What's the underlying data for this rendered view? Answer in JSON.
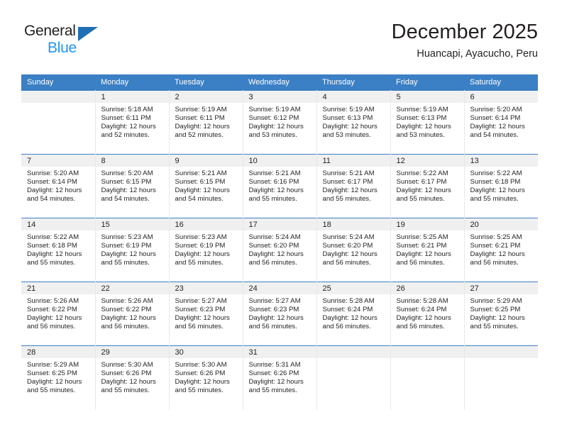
{
  "brand": {
    "name_top": "General",
    "name_bottom": "Blue",
    "triangle_color": "#1f6fb4",
    "blue_text_color": "#2196f3"
  },
  "header": {
    "title": "December 2025",
    "subtitle": "Huancapi, Ayacucho, Peru"
  },
  "theme": {
    "header_bg": "#3b7fc4",
    "header_text": "#ffffff",
    "daynum_bg": "#f0f0f0",
    "cell_border": "#e8e8e8",
    "text": "#231f20"
  },
  "labels": {
    "sunrise_prefix": "Sunrise: ",
    "sunset_prefix": "Sunset: ",
    "daylight_prefix": "Daylight: "
  },
  "weekdays": [
    "Sunday",
    "Monday",
    "Tuesday",
    "Wednesday",
    "Thursday",
    "Friday",
    "Saturday"
  ],
  "weeks": [
    [
      {
        "day": ""
      },
      {
        "day": "1",
        "sunrise": "Sunrise: 5:18 AM",
        "sunset": "Sunset: 6:11 PM",
        "daylight": "Daylight: 12 hours and 52 minutes."
      },
      {
        "day": "2",
        "sunrise": "Sunrise: 5:19 AM",
        "sunset": "Sunset: 6:11 PM",
        "daylight": "Daylight: 12 hours and 52 minutes."
      },
      {
        "day": "3",
        "sunrise": "Sunrise: 5:19 AM",
        "sunset": "Sunset: 6:12 PM",
        "daylight": "Daylight: 12 hours and 53 minutes."
      },
      {
        "day": "4",
        "sunrise": "Sunrise: 5:19 AM",
        "sunset": "Sunset: 6:13 PM",
        "daylight": "Daylight: 12 hours and 53 minutes."
      },
      {
        "day": "5",
        "sunrise": "Sunrise: 5:19 AM",
        "sunset": "Sunset: 6:13 PM",
        "daylight": "Daylight: 12 hours and 53 minutes."
      },
      {
        "day": "6",
        "sunrise": "Sunrise: 5:20 AM",
        "sunset": "Sunset: 6:14 PM",
        "daylight": "Daylight: 12 hours and 54 minutes."
      }
    ],
    [
      {
        "day": "7",
        "sunrise": "Sunrise: 5:20 AM",
        "sunset": "Sunset: 6:14 PM",
        "daylight": "Daylight: 12 hours and 54 minutes."
      },
      {
        "day": "8",
        "sunrise": "Sunrise: 5:20 AM",
        "sunset": "Sunset: 6:15 PM",
        "daylight": "Daylight: 12 hours and 54 minutes."
      },
      {
        "day": "9",
        "sunrise": "Sunrise: 5:21 AM",
        "sunset": "Sunset: 6:15 PM",
        "daylight": "Daylight: 12 hours and 54 minutes."
      },
      {
        "day": "10",
        "sunrise": "Sunrise: 5:21 AM",
        "sunset": "Sunset: 6:16 PM",
        "daylight": "Daylight: 12 hours and 55 minutes."
      },
      {
        "day": "11",
        "sunrise": "Sunrise: 5:21 AM",
        "sunset": "Sunset: 6:17 PM",
        "daylight": "Daylight: 12 hours and 55 minutes."
      },
      {
        "day": "12",
        "sunrise": "Sunrise: 5:22 AM",
        "sunset": "Sunset: 6:17 PM",
        "daylight": "Daylight: 12 hours and 55 minutes."
      },
      {
        "day": "13",
        "sunrise": "Sunrise: 5:22 AM",
        "sunset": "Sunset: 6:18 PM",
        "daylight": "Daylight: 12 hours and 55 minutes."
      }
    ],
    [
      {
        "day": "14",
        "sunrise": "Sunrise: 5:22 AM",
        "sunset": "Sunset: 6:18 PM",
        "daylight": "Daylight: 12 hours and 55 minutes."
      },
      {
        "day": "15",
        "sunrise": "Sunrise: 5:23 AM",
        "sunset": "Sunset: 6:19 PM",
        "daylight": "Daylight: 12 hours and 55 minutes."
      },
      {
        "day": "16",
        "sunrise": "Sunrise: 5:23 AM",
        "sunset": "Sunset: 6:19 PM",
        "daylight": "Daylight: 12 hours and 55 minutes."
      },
      {
        "day": "17",
        "sunrise": "Sunrise: 5:24 AM",
        "sunset": "Sunset: 6:20 PM",
        "daylight": "Daylight: 12 hours and 56 minutes."
      },
      {
        "day": "18",
        "sunrise": "Sunrise: 5:24 AM",
        "sunset": "Sunset: 6:20 PM",
        "daylight": "Daylight: 12 hours and 56 minutes."
      },
      {
        "day": "19",
        "sunrise": "Sunrise: 5:25 AM",
        "sunset": "Sunset: 6:21 PM",
        "daylight": "Daylight: 12 hours and 56 minutes."
      },
      {
        "day": "20",
        "sunrise": "Sunrise: 5:25 AM",
        "sunset": "Sunset: 6:21 PM",
        "daylight": "Daylight: 12 hours and 56 minutes."
      }
    ],
    [
      {
        "day": "21",
        "sunrise": "Sunrise: 5:26 AM",
        "sunset": "Sunset: 6:22 PM",
        "daylight": "Daylight: 12 hours and 56 minutes."
      },
      {
        "day": "22",
        "sunrise": "Sunrise: 5:26 AM",
        "sunset": "Sunset: 6:22 PM",
        "daylight": "Daylight: 12 hours and 56 minutes."
      },
      {
        "day": "23",
        "sunrise": "Sunrise: 5:27 AM",
        "sunset": "Sunset: 6:23 PM",
        "daylight": "Daylight: 12 hours and 56 minutes."
      },
      {
        "day": "24",
        "sunrise": "Sunrise: 5:27 AM",
        "sunset": "Sunset: 6:23 PM",
        "daylight": "Daylight: 12 hours and 56 minutes."
      },
      {
        "day": "25",
        "sunrise": "Sunrise: 5:28 AM",
        "sunset": "Sunset: 6:24 PM",
        "daylight": "Daylight: 12 hours and 56 minutes."
      },
      {
        "day": "26",
        "sunrise": "Sunrise: 5:28 AM",
        "sunset": "Sunset: 6:24 PM",
        "daylight": "Daylight: 12 hours and 56 minutes."
      },
      {
        "day": "27",
        "sunrise": "Sunrise: 5:29 AM",
        "sunset": "Sunset: 6:25 PM",
        "daylight": "Daylight: 12 hours and 55 minutes."
      }
    ],
    [
      {
        "day": "28",
        "sunrise": "Sunrise: 5:29 AM",
        "sunset": "Sunset: 6:25 PM",
        "daylight": "Daylight: 12 hours and 55 minutes."
      },
      {
        "day": "29",
        "sunrise": "Sunrise: 5:30 AM",
        "sunset": "Sunset: 6:26 PM",
        "daylight": "Daylight: 12 hours and 55 minutes."
      },
      {
        "day": "30",
        "sunrise": "Sunrise: 5:30 AM",
        "sunset": "Sunset: 6:26 PM",
        "daylight": "Daylight: 12 hours and 55 minutes."
      },
      {
        "day": "31",
        "sunrise": "Sunrise: 5:31 AM",
        "sunset": "Sunset: 6:26 PM",
        "daylight": "Daylight: 12 hours and 55 minutes."
      },
      {
        "day": ""
      },
      {
        "day": ""
      },
      {
        "day": ""
      }
    ]
  ]
}
